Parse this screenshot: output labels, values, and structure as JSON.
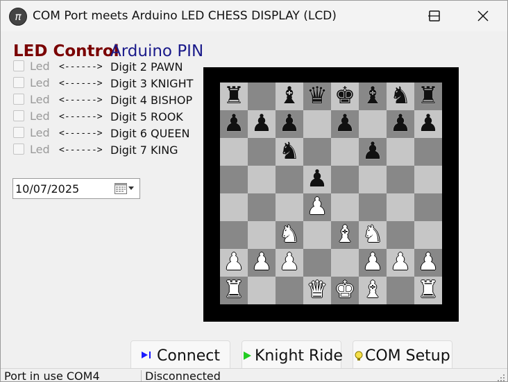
{
  "window": {
    "title": "COM Port meets Arduino LED CHESS DISPLAY (LCD)",
    "icon_glyph": "π",
    "minimize_icon": "minimize-icon",
    "maximize_icon": "maximize-icon",
    "close_icon": "close-icon"
  },
  "headers": {
    "led_control": "LED Control",
    "arduino_pin": "Arduino PIN"
  },
  "led_rows": [
    {
      "label": "Led",
      "arrow": "<------>",
      "digit": "Digit 2 PAWN",
      "checked": false
    },
    {
      "label": "Led",
      "arrow": "<------>",
      "digit": "Digit 3 KNIGHT",
      "checked": false
    },
    {
      "label": "Led",
      "arrow": "<------>",
      "digit": "Digit 4 BISHOP",
      "checked": false
    },
    {
      "label": "Led",
      "arrow": "<------>",
      "digit": "Digit 5 ROOK",
      "checked": false
    },
    {
      "label": "Led",
      "arrow": "<------>",
      "digit": "Digit 6 QUEEN",
      "checked": false
    },
    {
      "label": "Led",
      "arrow": "<------>",
      "digit": "Digit 7 KING",
      "checked": false
    }
  ],
  "date_picker": {
    "value": "10/07/2025",
    "icon": "calendar-icon"
  },
  "board": {
    "light_color": "#c6c6c6",
    "dark_color": "#888888",
    "frame_color": "#000000",
    "ranks": [
      [
        "bR",
        "",
        "bB",
        "bQ",
        "bK",
        "bB",
        "bN",
        "bR"
      ],
      [
        "bP",
        "bP",
        "bP",
        "",
        "bP",
        "",
        "bP",
        "bP"
      ],
      [
        "",
        "",
        "bN",
        "",
        "",
        "bP",
        "",
        ""
      ],
      [
        "",
        "",
        "",
        "bP",
        "",
        "",
        "",
        ""
      ],
      [
        "",
        "",
        "",
        "wP",
        "",
        "",
        "",
        ""
      ],
      [
        "",
        "",
        "wN",
        "",
        "wB",
        "wN",
        "",
        ""
      ],
      [
        "wP",
        "wP",
        "wP",
        "",
        "",
        "wP",
        "wP",
        "wP"
      ],
      [
        "wR",
        "",
        "",
        "wQ",
        "wK",
        "wB",
        "",
        "wR"
      ]
    ]
  },
  "buttons": {
    "connect": {
      "label": "Connect",
      "icon": "connect-icon",
      "icon_color": "#1a1aff"
    },
    "knight_ride": {
      "label": "Knight Ride",
      "icon": "play-icon",
      "icon_color": "#22cc22"
    },
    "com_setup": {
      "label": "COM Setup",
      "icon": "lightbulb-icon",
      "icon_color": "#e0c000"
    }
  },
  "status": {
    "port": "Port in use COM4",
    "connection": "Disconnected"
  }
}
